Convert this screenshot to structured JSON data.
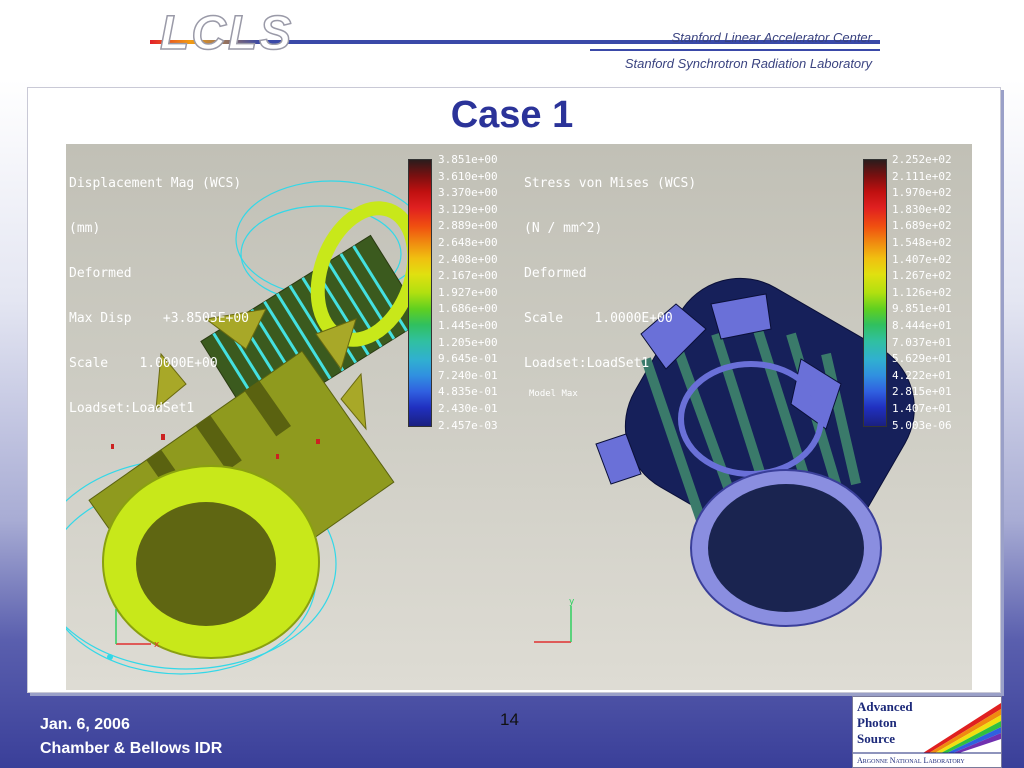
{
  "header": {
    "logo": "LCLS",
    "org1": "Stanford Linear Accelerator Center",
    "org2": "Stanford Synchrotron Radiation Laboratory"
  },
  "slide": {
    "title": "Case 1"
  },
  "left_view": {
    "info_lines": [
      "Displacement Mag (WCS)",
      "(mm)",
      "Deformed",
      "Max Disp    +3.8505E+00",
      "Scale    1.0000E+00",
      "Loadset:LoadSet1"
    ],
    "legend": [
      "3.851e+00",
      "3.610e+00",
      "3.370e+00",
      "3.129e+00",
      "2.889e+00",
      "2.648e+00",
      "2.408e+00",
      "2.167e+00",
      "1.927e+00",
      "1.686e+00",
      "1.445e+00",
      "1.205e+00",
      "9.645e-01",
      "7.240e-01",
      "4.835e-01",
      "2.430e-01",
      "2.457e-03"
    ],
    "axes": {
      "x": "x",
      "y": "y"
    }
  },
  "right_view": {
    "info_lines": [
      "Stress von Mises (WCS)",
      "(N / mm^2)",
      "Deformed",
      "Scale    1.0000E+00",
      "Loadset:LoadSet1"
    ],
    "model_label": "Model Max",
    "legend": [
      "2.252e+02",
      "2.111e+02",
      "1.970e+02",
      "1.830e+02",
      "1.689e+02",
      "1.548e+02",
      "1.407e+02",
      "1.267e+02",
      "1.126e+02",
      "9.851e+01",
      "8.444e+01",
      "7.037e+01",
      "5.629e+01",
      "4.222e+01",
      "2.815e+01",
      "1.407e+01",
      "5.003e-06"
    ],
    "axes": {
      "y": "y"
    }
  },
  "colors": {
    "title": "#2b3399",
    "header_text": "#3a4380",
    "footer_text": "#ffffff",
    "left_part": "#8f9a1e",
    "left_ring": "#c8e81a",
    "right_part": "#16205a",
    "right_ring": "#8a8ee0"
  },
  "footer": {
    "date": "Jan. 6, 2006",
    "event": "Chamber & Bellows IDR",
    "page_number": "14"
  },
  "aps_logo": {
    "line1": "Advanced",
    "line2": "Photon",
    "line3": "Source",
    "lab": "Argonne National Laboratory"
  }
}
